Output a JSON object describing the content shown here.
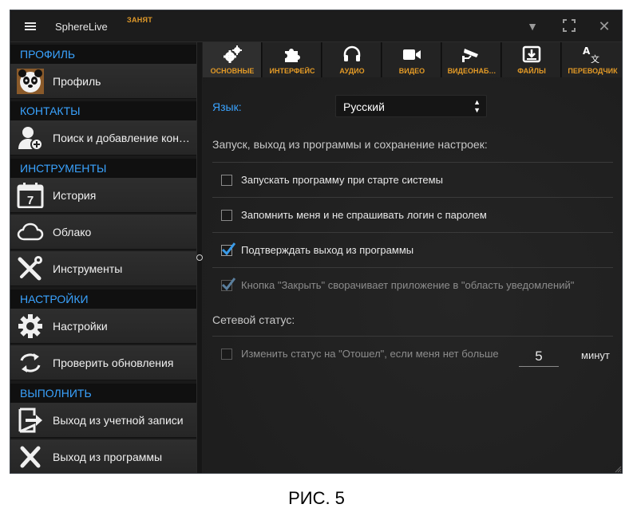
{
  "titlebar": {
    "app_name": "SphereLive",
    "status": "ЗАНЯТ"
  },
  "sidebar": {
    "sections": [
      {
        "header": "ПРОФИЛЬ",
        "items": [
          {
            "label": "Профиль",
            "icon": "panda-avatar-icon"
          }
        ]
      },
      {
        "header": "КОНТАКТЫ",
        "items": [
          {
            "label": "Поиск и добавление кон…",
            "icon": "add-contact-icon"
          }
        ]
      },
      {
        "header": "ИНСТРУМЕНТЫ",
        "items": [
          {
            "label": "История",
            "icon": "calendar-icon"
          },
          {
            "label": "Облако",
            "icon": "cloud-icon"
          },
          {
            "label": "Инструменты",
            "icon": "tools-icon"
          }
        ]
      },
      {
        "header": "НАСТРОЙКИ",
        "items": [
          {
            "label": "Настройки",
            "icon": "gear-icon"
          },
          {
            "label": "Проверить обновления",
            "icon": "refresh-icon"
          }
        ]
      },
      {
        "header": "ВЫПОЛНИТЬ",
        "items": [
          {
            "label": "Выход из учетной записи",
            "icon": "logout-icon"
          },
          {
            "label": "Выход из программы",
            "icon": "close-x-icon"
          }
        ]
      }
    ]
  },
  "tabs": [
    {
      "label": "ОСНОВНЫЕ",
      "icon": "gears-icon",
      "active": true
    },
    {
      "label": "ИНТЕРФЕЙС",
      "icon": "puzzle-icon",
      "active": false
    },
    {
      "label": "АУДИО",
      "icon": "headset-icon",
      "active": false
    },
    {
      "label": "ВИДЕО",
      "icon": "video-camera-icon",
      "active": false
    },
    {
      "label": "ВИДЕОНАБ…",
      "icon": "cctv-camera-icon",
      "active": false
    },
    {
      "label": "ФАЙЛЫ",
      "icon": "download-icon",
      "active": false
    },
    {
      "label": "ПЕРЕВОДЧИК",
      "icon": "translate-icon",
      "active": false
    }
  ],
  "settings": {
    "language_label": "Язык:",
    "language_value": "Русский",
    "startup_title": "Запуск, выход из программы и сохранение настроек:",
    "options": [
      {
        "label": "Запускать программу при старте системы",
        "checked": false,
        "enabled": true
      },
      {
        "label": "Запомнить меня и не спрашивать логин с паролем",
        "checked": false,
        "enabled": true
      },
      {
        "label": "Подтверждать выход из программы",
        "checked": true,
        "enabled": true
      },
      {
        "label": "Кнопка \"Закрыть\" сворачивает приложение в \"область уведомлений\"",
        "checked": true,
        "enabled": false
      }
    ],
    "network_title": "Сетевой статус:",
    "away_label": "Изменить статус на \"Отошел\", если меня нет больше",
    "away_minutes": "5",
    "minutes_unit": "минут"
  },
  "caption": "РИС. 5",
  "colors": {
    "accent_blue": "#3aa3ff",
    "tab_label_orange": "#e39a26",
    "checkmark_blue": "#3a9be8"
  }
}
